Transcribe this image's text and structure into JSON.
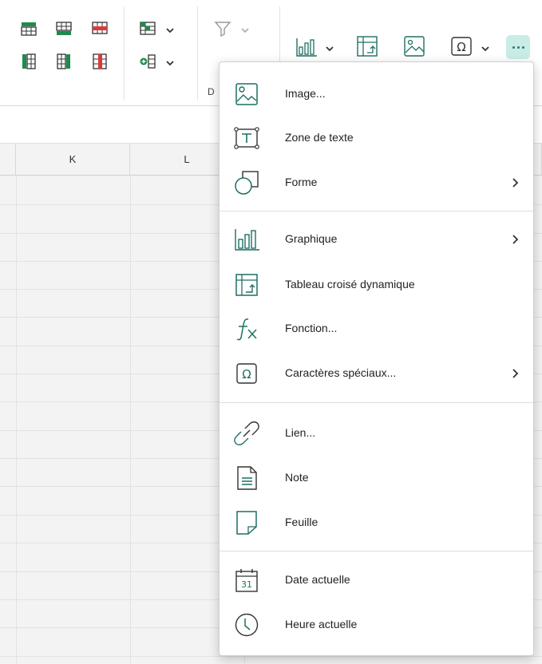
{
  "ribbon": {
    "group_label_partial": "D"
  },
  "sheet": {
    "columns": [
      "K",
      "L"
    ]
  },
  "menu": {
    "items": [
      {
        "label": "Image...",
        "icon": "image-icon",
        "submenu": false
      },
      {
        "label": "Zone de texte",
        "icon": "text-box-icon",
        "submenu": false
      },
      {
        "label": "Forme",
        "icon": "shape-icon",
        "submenu": true
      },
      {
        "label": "Graphique",
        "icon": "chart-icon",
        "submenu": true
      },
      {
        "label": "Tableau croisé dynamique",
        "icon": "pivot-table-icon",
        "submenu": false
      },
      {
        "label": "Fonction...",
        "icon": "function-icon",
        "submenu": false
      },
      {
        "label": "Caractères spéciaux...",
        "icon": "special-characters-icon",
        "submenu": true
      },
      {
        "label": "Lien...",
        "icon": "link-icon",
        "submenu": false
      },
      {
        "label": "Note",
        "icon": "note-icon",
        "submenu": false
      },
      {
        "label": "Feuille",
        "icon": "sheet-icon",
        "submenu": false
      },
      {
        "label": "Date actuelle",
        "icon": "calendar-icon",
        "submenu": false
      },
      {
        "label": "Heure actuelle",
        "icon": "clock-icon",
        "submenu": false
      }
    ],
    "calendar_day": "31"
  },
  "colors": {
    "accent": "#2d8a7c",
    "menu_icon": "#1f6f63",
    "more_button_bg": "#c9ece6",
    "table_green": "#1e8a4c",
    "table_red": "#d83b3b"
  }
}
